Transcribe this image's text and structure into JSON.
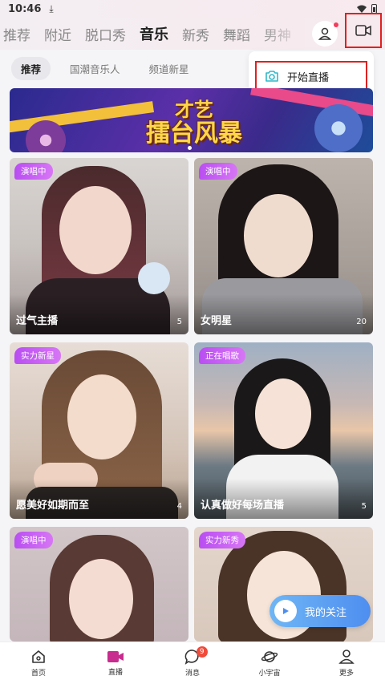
{
  "status_bar": {
    "time": "10:46"
  },
  "top_nav": {
    "tabs": [
      "推荐",
      "附近",
      "脱口秀",
      "音乐",
      "新秀",
      "舞蹈",
      "男神"
    ],
    "active_index": 3
  },
  "sub_tabs": {
    "items": [
      "推荐",
      "国潮音乐人",
      "频道新星"
    ],
    "active_index": 0
  },
  "popup": {
    "start_live_label": "开始直播"
  },
  "banner": {
    "line1": "才艺",
    "line2": "擂台风暴"
  },
  "cards": [
    {
      "badge": "演唱中",
      "name": "过气主播",
      "count": "5"
    },
    {
      "badge": "演唱中",
      "name": "女明星",
      "count": "20"
    },
    {
      "badge": "实力新星",
      "name": "愿美好如期而至",
      "count": "4"
    },
    {
      "badge": "正在唱歌",
      "name": "认真做好每场直播",
      "count": "5"
    },
    {
      "badge": "演唱中",
      "name": "",
      "count": ""
    },
    {
      "badge": "实力新秀",
      "name": "",
      "count": ""
    }
  ],
  "follow_button": {
    "label": "我的关注"
  },
  "bottom_nav": {
    "items": [
      "首页",
      "直播",
      "消息",
      "小宇宙",
      "更多"
    ],
    "active_index": 1,
    "message_badge": "9"
  },
  "colors": {
    "accent": "#c72c8e",
    "badge": "#c262f3",
    "highlight": "#e02020"
  }
}
